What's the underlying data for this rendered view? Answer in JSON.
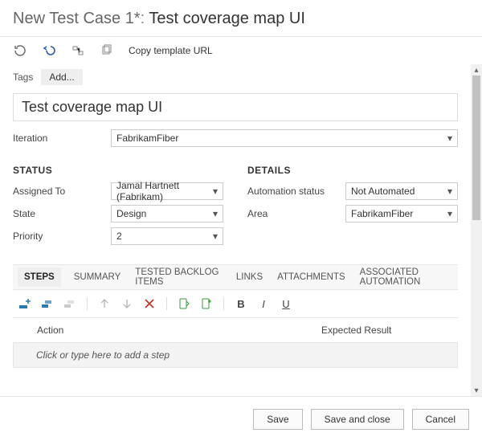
{
  "header": {
    "prefix": "New Test Case 1*",
    "separator": ": ",
    "title": "Test coverage map UI"
  },
  "toolbar": {
    "copy_template_label": "Copy template URL"
  },
  "tags": {
    "label": "Tags",
    "add_label": "Add..."
  },
  "title_input": {
    "value": "Test coverage map UI"
  },
  "iteration": {
    "label": "Iteration",
    "value": "FabrikamFiber"
  },
  "status": {
    "heading": "STATUS",
    "assigned_to": {
      "label": "Assigned To",
      "value": "Jamal Hartnett (Fabrikam)"
    },
    "state": {
      "label": "State",
      "value": "Design"
    },
    "priority": {
      "label": "Priority",
      "value": "2"
    }
  },
  "details": {
    "heading": "DETAILS",
    "automation_status": {
      "label": "Automation status",
      "value": "Not Automated"
    },
    "area": {
      "label": "Area",
      "value": "FabrikamFiber"
    }
  },
  "tabs": {
    "items": [
      "STEPS",
      "SUMMARY",
      "TESTED BACKLOG ITEMS",
      "LINKS",
      "ATTACHMENTS",
      "ASSOCIATED AUTOMATION"
    ],
    "active_index": 0
  },
  "steps": {
    "columns": {
      "action": "Action",
      "expected": "Expected Result"
    },
    "placeholder": "Click or type here to add a step"
  },
  "footer": {
    "save": "Save",
    "save_close": "Save and close",
    "cancel": "Cancel"
  }
}
